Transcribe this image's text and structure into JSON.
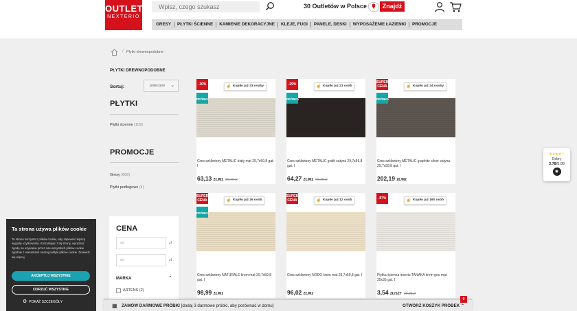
{
  "brand": {
    "logo_line1": "OUTLET",
    "logo_line2": "NEXTERIO",
    "accent": "#d5121b",
    "teal": "#16a6a5"
  },
  "header": {
    "search_placeholder": "Wpisz, czego szukasz",
    "outlets_text": "30 Outletów w Polsce",
    "find_button": "Znajdź",
    "icons": [
      "search-icon",
      "map-pin-icon",
      "user-icon",
      "cart-icon"
    ]
  },
  "nav": [
    "GRESY",
    "PŁYTKI ŚCIENNE",
    "KAMIENIE DEKORACYJNE",
    "KLEJE, FUGI",
    "PANELE, DESKI",
    "WYPOSAŻENIE ŁAZIENKI",
    "PROMOCJE"
  ],
  "breadcrumb": {
    "current": "Płytki drewnopodobne"
  },
  "page": {
    "title": "PŁYTKI DREWNOPODOBNE",
    "sort_label": "Sortuj:",
    "sort_value": "polecane"
  },
  "sidebar": {
    "plytki": {
      "heading": "PŁYTKI",
      "items": [
        {
          "label": "Płytki ścienne",
          "count": "(109)"
        }
      ]
    },
    "promocje": {
      "heading": "PROMOCJE",
      "items": [
        {
          "label": "Gresy",
          "count": "(606)"
        },
        {
          "label": "Płytki podłogowe",
          "count": "(4)"
        }
      ]
    },
    "cena": {
      "heading": "CENA",
      "from_placeholder": "od",
      "to_placeholder": "do",
      "currency": "zł"
    },
    "marka": {
      "heading": "MARKA",
      "first_option": "ARTENS (2)"
    }
  },
  "products": [
    {
      "badge": "-30%",
      "badge2": "PRÓBKA",
      "bought": "Kupiło już 33 osoby",
      "name": "Gres szkliwiony METALIC biały mat 29,7x59,8 gat. I",
      "price": "63,13",
      "unit": "ZŁ/M2",
      "old": "90,19 zł",
      "tile": "#ddd8cc"
    },
    {
      "badge": "-29%",
      "badge2": "PRÓBKA",
      "bought": "Kupiło już 23 osób",
      "name": "Gres szkliwiony METALIC grafit satyna 29,7x59,8 gat. I",
      "price": "64,27",
      "unit": "ZŁ/M2",
      "old": "90,19 zł",
      "tile": "#2a2522"
    },
    {
      "badge": "SUPER CENA",
      "badge2": "PRÓBKA",
      "bought": "Kupiło już 34 osoby",
      "name": "Gres szkliwiony METALIC graphite silver satyna 29,7x59,8 gat. I",
      "price": "202,19",
      "unit": "ZŁ/M2",
      "old": "",
      "tile": "#5c5550"
    },
    {
      "badge": "SUPER CENA",
      "badge2": "PRÓBKA",
      "bought": "Kupiło już 26 osób",
      "name": "Gres szkliwiony NATURALE krem mat 29,7x59,8 gat. I",
      "price": "98,99",
      "unit": "ZŁ/M2",
      "old": "",
      "tile": "#e8dcc1"
    },
    {
      "badge": "SUPER CENA",
      "badge2": "",
      "bought": "Kupiło już 12 osób",
      "name": "Gres szkliwiony NODO krem mat 29,7x59,8 gat. I",
      "price": "96,02",
      "unit": "ZŁ/M2",
      "old": "",
      "tile": "#ecdfc6"
    },
    {
      "badge": "-87%",
      "badge2": "",
      "bought": "Kupiło już 160 osób",
      "name": "Płytka ścienna inserto TANAKA krem geo mat 25x35 gat. I",
      "price": "3,54",
      "unit": "ZŁ/SZT",
      "old": "28,99 zł",
      "tile": "#eae6e1"
    }
  ],
  "cookie": {
    "title": "Ta strona używa plików cookie",
    "body": "Ta strona korzysta z plików cookie, aby zapewnić lepszą wygodę użytkownika. Korzystając z tej strony, wyrażasz zgodę na używanie przez nas wszystkich plików cookie zgodnie z warunkami naszej polityki plików cookie. Dowiedz się więcej",
    "accept": "AKCEPTUJ WSZYSTKIE",
    "reject": "ODRZUĆ WSZYSTKIE",
    "details": "POKAŻ SZCZEGÓŁY"
  },
  "rating": {
    "label": "Dobry",
    "score": "3.78",
    "of": "/5.00"
  },
  "sample_bar": {
    "bold": "ZAMÓW DARMOWE PRÓBKI",
    "rest": "[dodaj 3 darmowe próbki, aby porównać w domu]",
    "right": "OTWÓRZ KOSZYK PRÓBEK",
    "count": "0"
  }
}
